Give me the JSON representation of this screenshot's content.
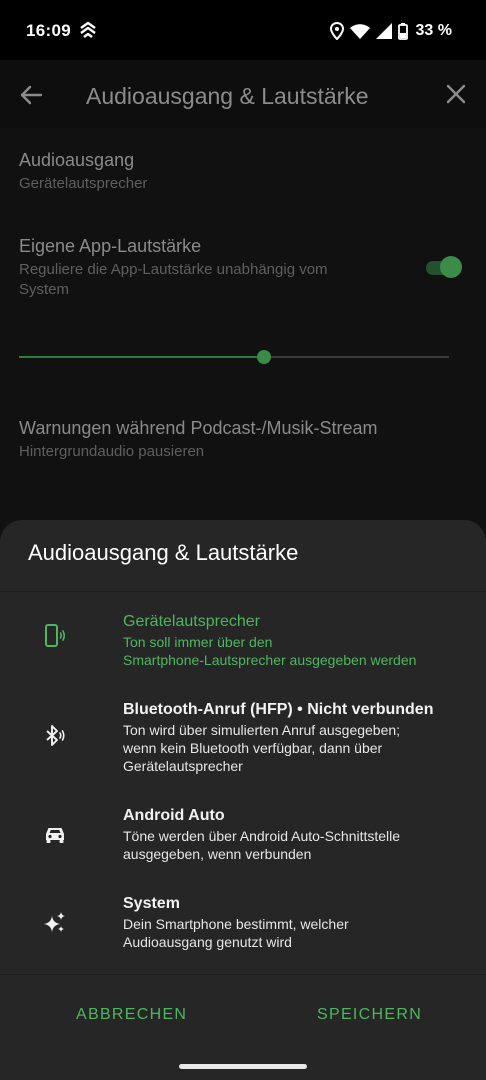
{
  "status_bar": {
    "time": "16:09",
    "battery": "33 %",
    "icons": [
      "app-notification-icon",
      "location-icon",
      "wifi-icon",
      "signal-icon",
      "battery-icon"
    ]
  },
  "toolbar": {
    "title": "Audioausgang & Lautstärke",
    "icons": [
      "back-arrow-icon",
      "close-icon"
    ]
  },
  "settings": {
    "audio_output": {
      "title": "Audioausgang",
      "value": "Gerätelautsprecher"
    },
    "app_volume": {
      "title": "Eigene App-Lautstärke",
      "subtitle_line1": "Reguliere die App-Lautstärke unabhängig vom",
      "subtitle_line2": "System",
      "enabled": true,
      "volume_fraction": 0.57
    },
    "warnings": {
      "title": "Warnungen während Podcast-/Musik-Stream",
      "subtitle": "Hintergrundaudio pausieren"
    }
  },
  "dialog": {
    "title": "Audioausgang & Lautstärke",
    "options": [
      {
        "icon": "phone-speaker-icon",
        "title": "Gerätelautsprecher",
        "desc_line1": "Ton soll immer über den",
        "desc_line2": "Smartphone-Lautsprecher ausgegeben werden",
        "desc_line3": "",
        "selected": true
      },
      {
        "icon": "bluetooth-audio-icon",
        "title": "Bluetooth-Anruf (HFP) • Nicht verbunden",
        "desc_line1": "Ton wird über simulierten Anruf ausgegeben;",
        "desc_line2": "wenn kein Bluetooth verfügbar, dann über",
        "desc_line3": "Gerätelautsprecher",
        "selected": false
      },
      {
        "icon": "car-icon",
        "title": "Android Auto",
        "desc_line1": "Töne werden über Android Auto-Schnittstelle",
        "desc_line2": "ausgegeben, wenn verbunden",
        "desc_line3": "",
        "selected": false
      },
      {
        "icon": "sparkles-icon",
        "title": "System",
        "desc_line1": "Dein Smartphone bestimmt, welcher",
        "desc_line2": "Audioausgang genutzt wird",
        "desc_line3": "",
        "selected": false
      }
    ],
    "cancel_label": "ABBRECHEN",
    "save_label": "SPEICHERN"
  },
  "colors": {
    "accent": "#4cb85e",
    "sheet_background": "#262626",
    "page_background": "#111111"
  }
}
